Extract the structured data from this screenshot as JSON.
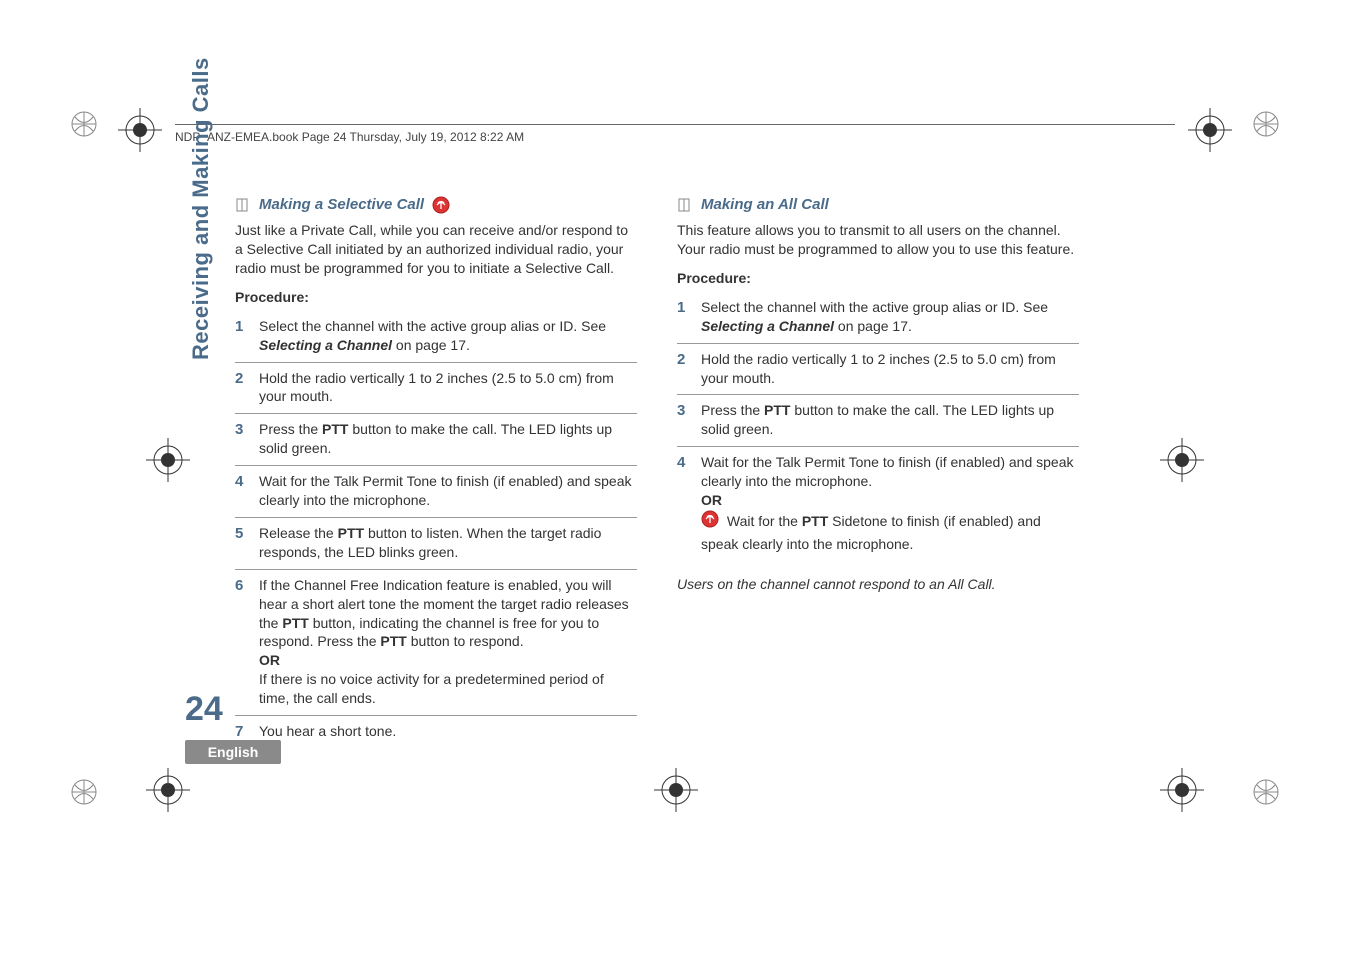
{
  "header": "NDP_ANZ-EMEA.book  Page 24  Thursday, July 19, 2012  8:22 AM",
  "sidebar_label": "Receiving and Making Calls",
  "page_number": "24",
  "language": "English",
  "left": {
    "title": "Making a Selective Call",
    "intro": "Just like a Private Call, while you can receive and/or respond to a Selective Call initiated by an authorized individual radio, your radio must be programmed for you to initiate a Selective Call.",
    "procedure_label": "Procedure:",
    "steps": [
      {
        "n": "1",
        "pre": "Select the channel with the active group alias or ID. See ",
        "ref": "Selecting a Channel",
        "post": " on page 17."
      },
      {
        "n": "2",
        "text": "Hold the radio vertically 1 to 2 inches (2.5 to 5.0 cm) from your mouth."
      },
      {
        "n": "3",
        "pre": "Press the ",
        "bold": "PTT",
        "post": " button to make the call. The LED lights up solid green."
      },
      {
        "n": "4",
        "text": "Wait for the Talk Permit Tone to finish (if enabled) and speak clearly into the microphone."
      },
      {
        "n": "5",
        "pre": "Release the ",
        "bold": "PTT",
        "post": " button to listen. When the target radio responds, the LED blinks green."
      },
      {
        "n": "6",
        "pre": "If the Channel Free Indication feature is enabled, you will hear a short alert tone the moment the target radio releases the ",
        "bold": "PTT",
        "mid": " button, indicating the channel is free for you to respond. Press the ",
        "bold2": "PTT",
        "post": " button to respond.",
        "or": "OR",
        "tail": "If there is no voice activity for a predetermined period of time, the call ends."
      },
      {
        "n": "7",
        "text": "You hear a short tone."
      }
    ]
  },
  "right": {
    "title": "Making an All Call",
    "intro": "This feature allows you to transmit to all users on the channel. Your radio must be programmed to allow you to use this feature.",
    "procedure_label": "Procedure:",
    "steps": [
      {
        "n": "1",
        "pre": "Select the channel with the active group alias or ID. See ",
        "ref": "Selecting a Channel",
        "post": " on page 17."
      },
      {
        "n": "2",
        "text": "Hold the radio vertically 1 to 2 inches (2.5 to 5.0 cm) from your mouth."
      },
      {
        "n": "3",
        "pre": "Press the ",
        "bold": "PTT",
        "post": " button to make the call. The LED lights up solid green."
      },
      {
        "n": "4",
        "text": "Wait for the Talk Permit Tone to finish (if enabled) and speak clearly into the microphone.",
        "or": "OR",
        "badgetail_pre": "Wait for the ",
        "badgetail_bold": "PTT",
        "badgetail_post": " Sidetone to finish (if enabled) and speak clearly into the microphone."
      }
    ],
    "note": "Users on the channel cannot respond to an All Call."
  }
}
